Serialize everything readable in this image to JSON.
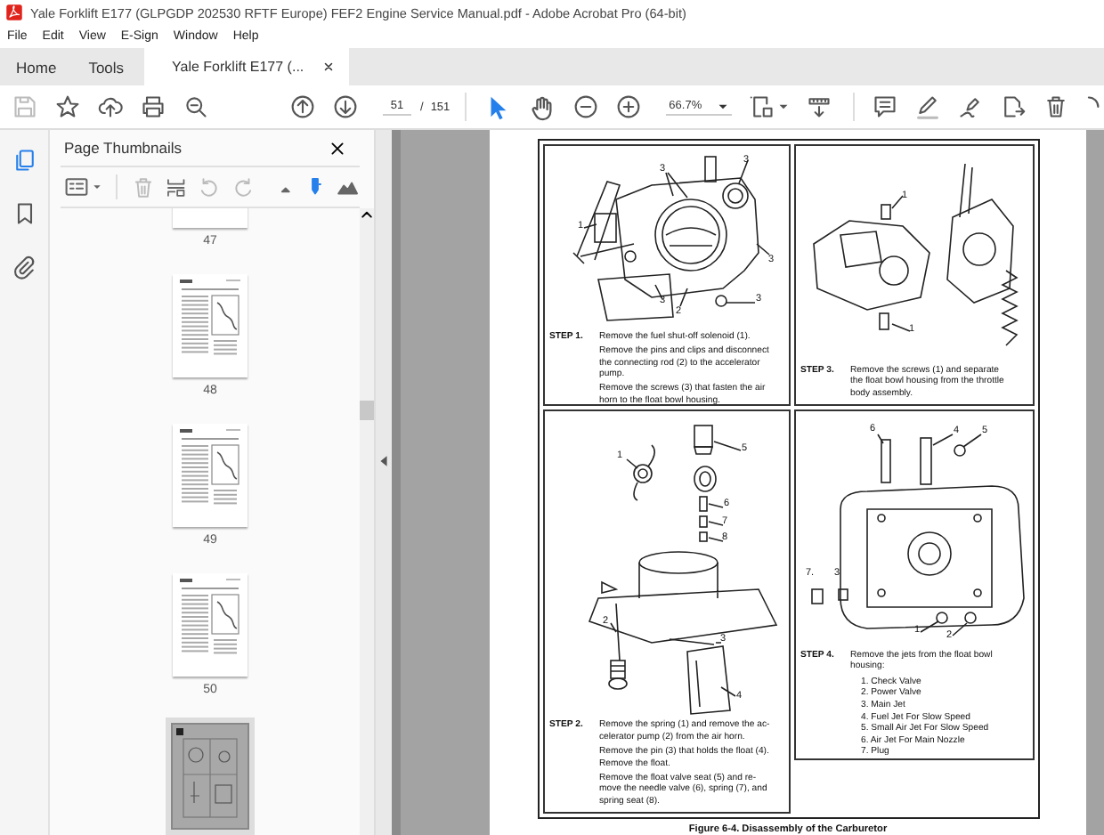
{
  "window": {
    "title": "Yale Forklift E177 (GLPGDP 202530 RFTF Europe) FEF2 Engine Service Manual.pdf - Adobe Acrobat Pro (64-bit)"
  },
  "menu": [
    "File",
    "Edit",
    "View",
    "E-Sign",
    "Window",
    "Help"
  ],
  "tabs": [
    {
      "label": "Home",
      "selected": false
    },
    {
      "label": "Tools",
      "selected": false
    },
    {
      "label": "Yale Forklift E177 (...",
      "selected": true
    }
  ],
  "toolbar": {
    "page_current": "51",
    "page_separator": "/",
    "page_total": "151",
    "zoom": "66.7%",
    "view_tools": [
      {
        "kind": "select",
        "selected": true
      },
      {
        "kind": "hand",
        "selected": false
      }
    ]
  },
  "sidebar": {
    "title": "Page Thumbnails",
    "thumbnails": [
      {
        "label": "47",
        "selected": false
      },
      {
        "label": "48",
        "selected": false
      },
      {
        "label": "49",
        "selected": false
      },
      {
        "label": "50",
        "selected": false
      },
      {
        "selected": true
      }
    ]
  },
  "document": {
    "panels": [
      {
        "step": "STEP 1.",
        "paragraphs": [
          "Remove the fuel shut-off solenoid (1).",
          "Remove the pins and clips and disconnect\nthe connecting rod (2) to the accelerator\npump.",
          "Remove the screws (3) that fasten the air\nhorn to the float bowl housing."
        ],
        "callouts": [
          "3",
          "3",
          "1",
          "3",
          "3",
          "2",
          "3"
        ]
      },
      {
        "step": "STEP 3.",
        "paragraphs": [
          "Remove the screws (1) and separate\nthe float bowl housing from the throttle\nbody assembly."
        ],
        "callouts": [
          "1",
          "1"
        ]
      },
      {
        "step": "STEP 2.",
        "paragraphs": [
          "Remove the spring (1) and remove the ac-\ncelerator pump (2) from the air horn.",
          "Remove the pin (3) that holds the float (4).\nRemove the float.",
          "Remove the float valve seat (5) and re-\nmove the needle valve (6), spring (7), and\nspring seat (8)."
        ],
        "callouts": [
          "5",
          "1",
          "6",
          "7",
          "8",
          "2",
          "3",
          "4"
        ]
      },
      {
        "step": "STEP 4.",
        "paragraphs": [
          "Remove the jets from the float bowl\nhousing:"
        ],
        "list": [
          "1. Check Valve",
          "2. Power Valve",
          "3. Main Jet",
          "4. Fuel Jet For Slow Speed",
          "5. Small Air Jet For Slow Speed",
          "6. Air Jet For Main Nozzle",
          "7. Plug"
        ],
        "callouts": [
          "6",
          "4",
          "5",
          "7.",
          "3",
          "1",
          "2"
        ]
      }
    ],
    "caption": "Figure 6-4. Disassembly of the Carburetor"
  }
}
